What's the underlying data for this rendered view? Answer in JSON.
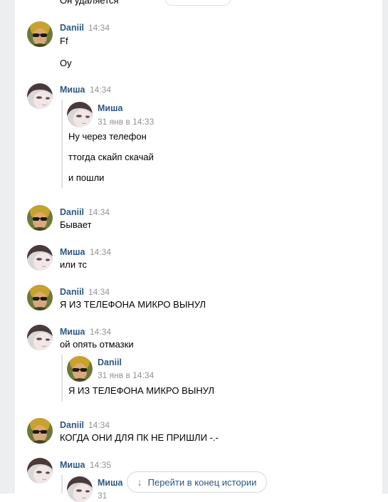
{
  "colors": {
    "name": "#2a5885",
    "time": "#939393",
    "bar": "#dee1e6",
    "background": "#ffffff"
  },
  "top_partial_text": "Он удаляется",
  "messages": [
    {
      "author": "Daniil",
      "time": "14:34",
      "avatar": "avatar-daniil",
      "lines": [
        "Ff",
        "Oy"
      ]
    },
    {
      "author": "Миша",
      "time": "14:34",
      "avatar": "avatar-misha",
      "forwarded": {
        "author": "Миша",
        "time": "31 янв в 14:33",
        "lines": [
          "Ну через телефон",
          "ттогда скайп скачай",
          "и пошли"
        ]
      }
    },
    {
      "author": "Daniil",
      "time": "14:34",
      "avatar": "avatar-daniil",
      "lines": [
        "Бывает"
      ]
    },
    {
      "author": "Миша",
      "time": "14:34",
      "avatar": "avatar-misha",
      "lines": [
        "или тс"
      ]
    },
    {
      "author": "Daniil",
      "time": "14:34",
      "avatar": "avatar-daniil",
      "lines": [
        "Я ИЗ ТЕЛЕФОНА МИКРО ВЫНУЛ"
      ]
    },
    {
      "author": "Миша",
      "time": "14:34",
      "avatar": "avatar-misha",
      "lines": [
        "ой опять отмазки"
      ],
      "forwarded": {
        "author": "Daniil",
        "time": "31 янв в 14:34",
        "lines": [
          "Я ИЗ ТЕЛЕФОНА МИКРО ВЫНУЛ"
        ]
      }
    },
    {
      "author": "Daniil",
      "time": "14:34",
      "avatar": "avatar-daniil",
      "lines": [
        "КОГДА ОНИ ДЛЯ ПК НЕ ПРИШЛИ -.-"
      ]
    },
    {
      "author": "Миша",
      "time": "14:35",
      "avatar": "avatar-misha",
      "forwarded": {
        "author": "Миша",
        "time": "31",
        "lines": []
      }
    }
  ],
  "jump_button": {
    "label": "Перейти в конец истории",
    "icon": "arrow-down-icon"
  }
}
